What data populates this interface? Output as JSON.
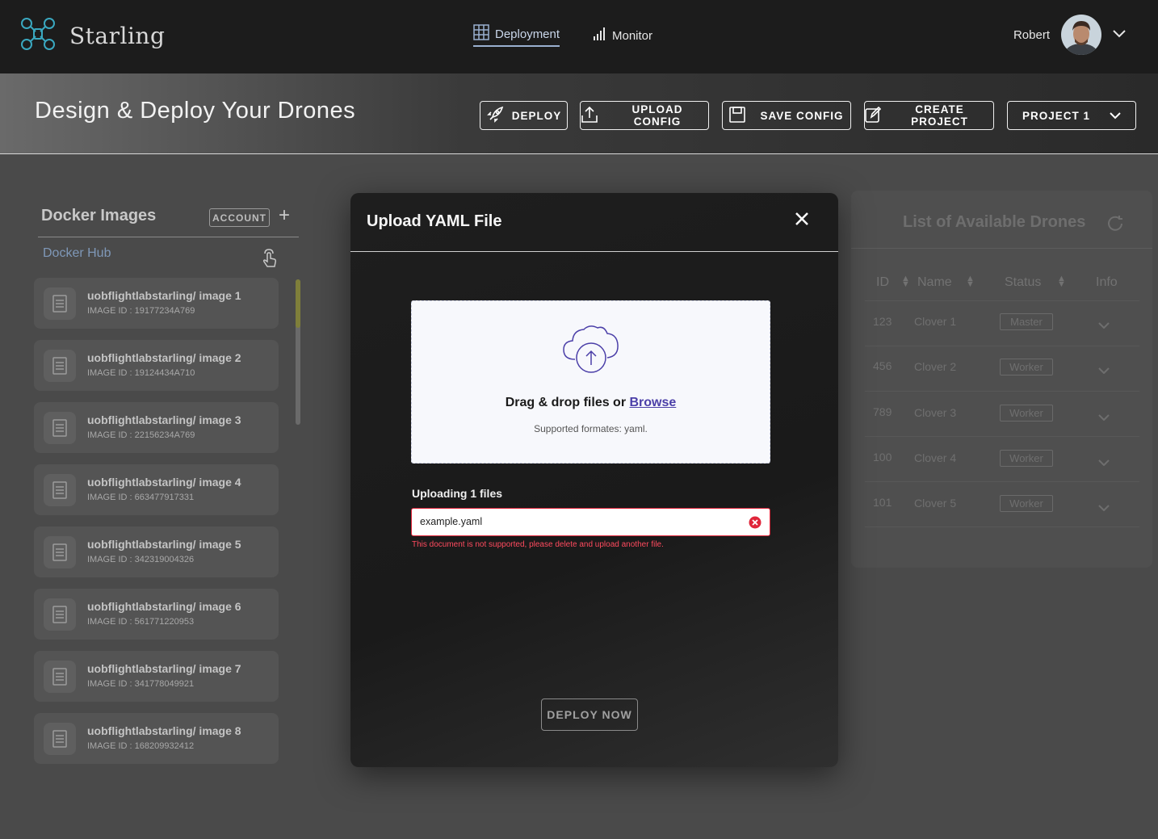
{
  "app": {
    "name": "Starling"
  },
  "nav": {
    "deployment_label": "Deployment",
    "monitor_label": "Monitor",
    "user_name": "Robert"
  },
  "header": {
    "title": "Design & Deploy Your Drones",
    "deploy_label": "DEPLOY",
    "upload_config_label": "UPLOAD CONFIG",
    "save_config_label": "SAVE CONFIG",
    "create_project_label": "CREATE PROJECT",
    "project_select_label": "PROJECT 1"
  },
  "docker_panel": {
    "title": "Docker Images",
    "account_label": "ACCOUNT",
    "add_label": "+",
    "hub_label": "Docker Hub",
    "images": [
      {
        "name": "uobflightlabstarling/ image 1",
        "id": "IMAGE ID : 19177234A769"
      },
      {
        "name": "uobflightlabstarling/ image 2",
        "id": "IMAGE ID : 19124434A710"
      },
      {
        "name": "uobflightlabstarling/ image 3",
        "id": "IMAGE ID : 22156234A769"
      },
      {
        "name": "uobflightlabstarling/ image 4",
        "id": "IMAGE ID : 663477917331"
      },
      {
        "name": "uobflightlabstarling/ image 5",
        "id": "IMAGE ID : 342319004326"
      },
      {
        "name": "uobflightlabstarling/ image 6",
        "id": "IMAGE ID : 561771220953"
      },
      {
        "name": "uobflightlabstarling/ image 7",
        "id": "IMAGE ID : 341778049921"
      },
      {
        "name": "uobflightlabstarling/ image 8",
        "id": "IMAGE ID : 168209932412"
      }
    ]
  },
  "drones_panel": {
    "title": "List of Available Drones",
    "columns": [
      "ID",
      "Name",
      "Status",
      "Info"
    ],
    "rows": [
      {
        "id": "123",
        "name": "Clover 1",
        "status": "Master"
      },
      {
        "id": "456",
        "name": "Clover 2",
        "status": "Worker"
      },
      {
        "id": "789",
        "name": "Clover 3",
        "status": "Worker"
      },
      {
        "id": "100",
        "name": "Clover 4",
        "status": "Worker"
      },
      {
        "id": "101",
        "name": "Clover 5",
        "status": "Worker"
      }
    ]
  },
  "modal": {
    "title": "Upload YAML File",
    "drop_text": "Drag & drop files or ",
    "browse_label": "Browse",
    "supported_text": "Supported formates:  yaml.",
    "uploading_label": "Uploading 1 files",
    "file_name": "example.yaml",
    "error_message": "This document is not supported, please delete and upload another file.",
    "deploy_now_label": "DEPLOY NOW"
  },
  "colors": {
    "accent_blue": "#9ab0d0",
    "error_red": "#e0263a",
    "browse_purple": "#4b3fa8",
    "scroll_thumb": "#7f7f3a"
  }
}
